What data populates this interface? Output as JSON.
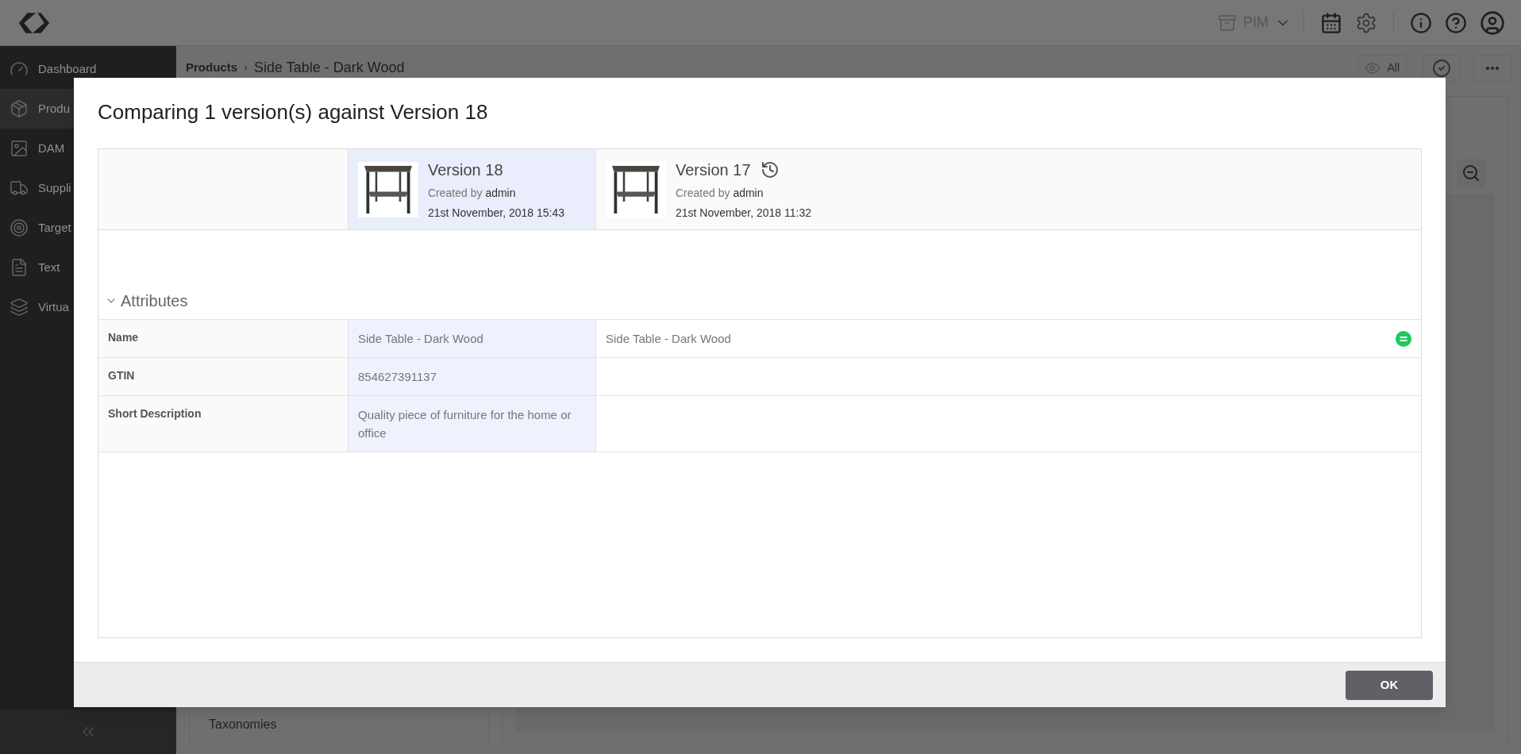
{
  "topbar": {
    "module": "PIM"
  },
  "sidebar": {
    "items": [
      {
        "label": "Dashboard",
        "selected": false
      },
      {
        "label": "Produ",
        "selected": true
      },
      {
        "label": "DAM",
        "selected": false
      },
      {
        "label": "Suppli",
        "selected": false
      },
      {
        "label": "Target",
        "selected": false
      },
      {
        "label": "Text",
        "selected": false
      },
      {
        "label": "Virtua",
        "selected": false
      }
    ]
  },
  "breadcrumb": {
    "parent": "Products",
    "separator": "›",
    "current": "Side Table - Dark Wood"
  },
  "toolbar": {
    "view_filter": "All"
  },
  "left_panel": {
    "items": [
      "Taxonomies"
    ]
  },
  "dialog": {
    "title": "Comparing 1 version(s) against Version 18",
    "versions": [
      {
        "name": "Version 18",
        "created_label": "Created by",
        "author": "admin",
        "date": "21st November, 2018 15:43",
        "selected": true,
        "restorable": false
      },
      {
        "name": "Version 17",
        "created_label": "Created by",
        "author": "admin",
        "date": "21st November, 2018 11:32",
        "selected": false,
        "restorable": true
      }
    ],
    "section": {
      "title": "Attributes",
      "expanded": true
    },
    "rows": [
      {
        "label": "Name",
        "values": [
          "Side Table - Dark Wood",
          "Side Table - Dark Wood"
        ],
        "equal": true
      },
      {
        "label": "GTIN",
        "values": [
          "854627391137"
        ],
        "equal": false
      },
      {
        "label": "Short Description",
        "values": [
          "Quality piece of furniture for the home or office"
        ],
        "equal": false
      }
    ],
    "button": "OK"
  }
}
